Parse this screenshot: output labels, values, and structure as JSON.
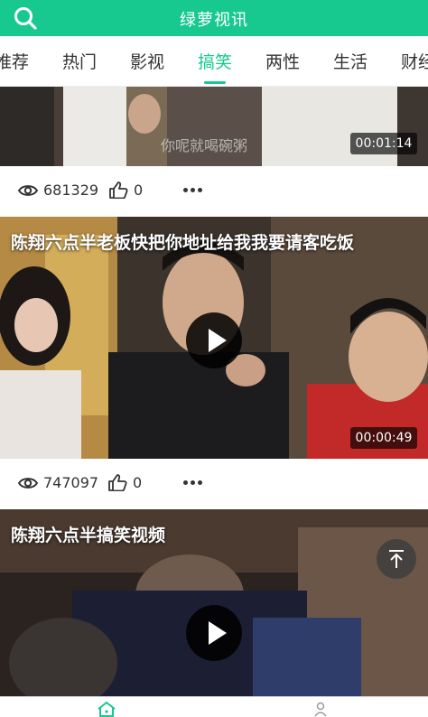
{
  "header": {
    "title": "绿萝视讯",
    "search_icon": "search-icon",
    "color": "#17c98f"
  },
  "tabs": [
    {
      "label": "推荐"
    },
    {
      "label": "热门"
    },
    {
      "label": "影视"
    },
    {
      "label": "搞笑",
      "active": true
    },
    {
      "label": "两性"
    },
    {
      "label": "生活"
    },
    {
      "label": "财经"
    }
  ],
  "feed": [
    {
      "subtitle": "你呢就喝碗粥",
      "duration": "00:01:14",
      "views": "681329",
      "likes": "0"
    },
    {
      "title": "陈翔六点半老板快把你地址给我我要请客吃饭",
      "duration": "00:00:49",
      "views": "747097",
      "likes": "0"
    },
    {
      "title": "陈翔六点半搞笑视频"
    }
  ],
  "bottom_nav": {
    "home_icon": "home-icon",
    "user_icon": "user-icon"
  }
}
